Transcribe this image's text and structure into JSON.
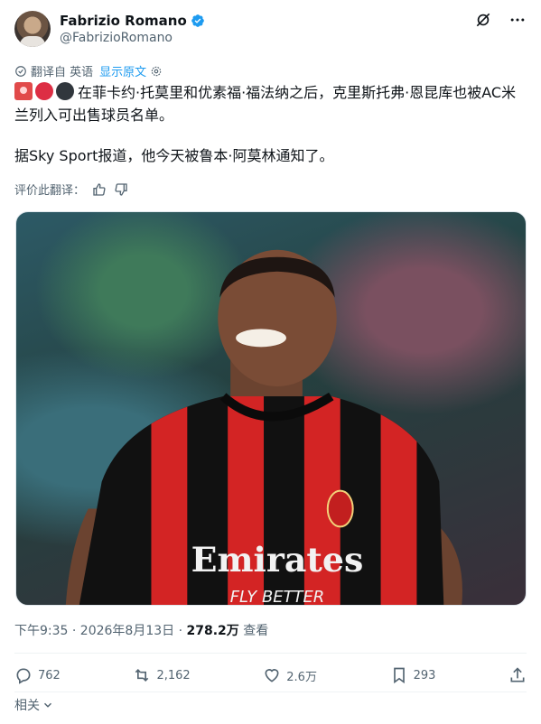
{
  "author": {
    "name": "Fabrizio Romano",
    "handle": "@FabrizioRomano"
  },
  "header_icons": [
    "grok-icon",
    "more-icon"
  ],
  "translation": {
    "label": "翻译自 英语",
    "show_original": "显示原文"
  },
  "tweet": {
    "emojis": [
      "siren-emoji",
      "red-circle-emoji",
      "black-circle-emoji"
    ],
    "line1": "在菲卡约·托莫里和优素福·福法纳之后，克里斯托弗·恩昆库也被AC米兰列入可出售球员名单。",
    "line2": "据Sky Sport报道，他今天被鲁本·阿莫林通知了。"
  },
  "rate_translation": "评价此翻译：",
  "media": {
    "jersey_sponsor_top": "Emirates",
    "jersey_sponsor_bottom": "FLY BETTER"
  },
  "meta": {
    "time": "下午9:35 · 2026年8月13日 · ",
    "views_count": "278.2万",
    "views_label": " 查看"
  },
  "actions": {
    "replies": "762",
    "reposts": "2,162",
    "likes": "2.6万",
    "bookmarks": "293"
  },
  "related": "相关"
}
